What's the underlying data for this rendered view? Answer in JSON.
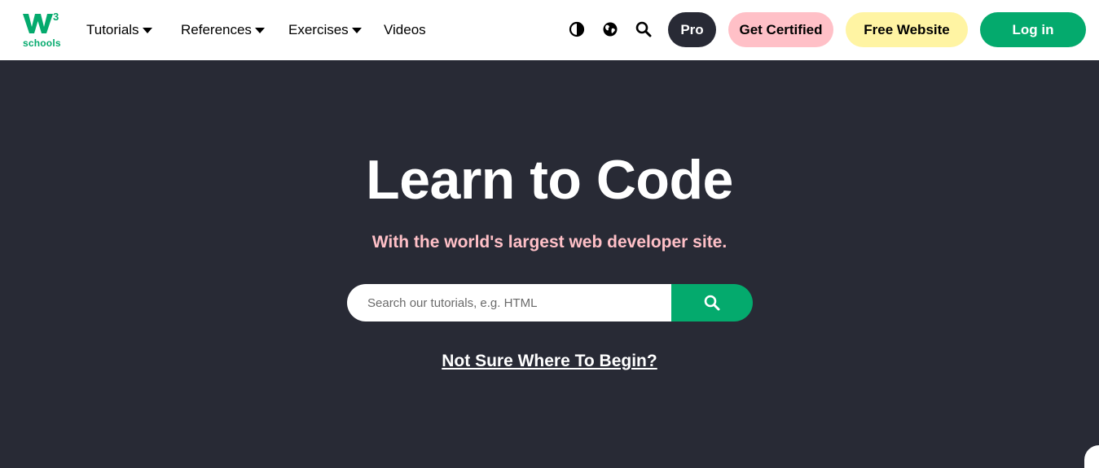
{
  "logo": {
    "superscript": "3",
    "wordmark": "schools",
    "brand_color": "#04aa6d"
  },
  "nav": {
    "items": [
      {
        "label": "Tutorials",
        "has_dropdown": true
      },
      {
        "label": "References",
        "has_dropdown": true
      },
      {
        "label": "Exercises",
        "has_dropdown": true
      },
      {
        "label": "Videos",
        "has_dropdown": false
      }
    ],
    "icons": [
      "contrast-icon",
      "globe-icon",
      "search-icon"
    ]
  },
  "buttons": {
    "pro": "Pro",
    "get_certified": "Get Certified",
    "free_website": "Free Website",
    "login": "Log in"
  },
  "colors": {
    "pro_bg": "#282a35",
    "certified_bg": "#ffc0c7",
    "free_website_bg": "#fff4a3",
    "login_bg": "#04aa6d",
    "hero_bg": "#282a35",
    "subtitle": "#ffc0c7"
  },
  "hero": {
    "title": "Learn to Code",
    "subtitle": "With the world's largest web developer site.",
    "search_placeholder": "Search our tutorials, e.g. HTML",
    "begin_link": "Not Sure Where To Begin?"
  }
}
